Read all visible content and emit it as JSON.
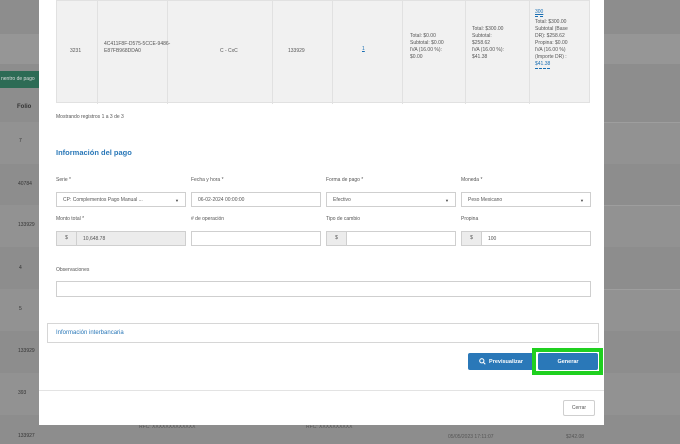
{
  "background": {
    "tab_label": "nentro de pago",
    "folio_header": "Folio",
    "folio_rows": [
      "7",
      "40784",
      "133929",
      "4",
      "5",
      "133929",
      "393",
      "133927"
    ],
    "bottom_texts": [
      "RFC: XXXXXXXXXXXXX",
      "RFC: XXXXXXXXXX",
      "05/05/2023 17:11:07",
      "$242.08"
    ]
  },
  "table": {
    "row": {
      "num": "3231",
      "uuid": "4C411F8F-D575-5CCE-9486-E87FB968DDA0",
      "type": "C - CxC",
      "folio": "133929",
      "link": "1",
      "col1": [
        "Total: $0.00",
        "Subtotal: $0.00",
        "IVA (16.00 %):",
        "$0.00"
      ],
      "col2": [
        "Total: $300.00",
        "Subtotal:",
        "$258.62",
        "IVA (16.00 %):",
        "$41.38"
      ],
      "col3_link": "300",
      "col3": [
        "Total: $300.00",
        "Subtotal (Base",
        "DR): $258.62",
        "Propina: $0.00",
        "IVA (16.00 %)",
        "(Importe DR) :",
        "$41.38"
      ]
    }
  },
  "showing_text": "Mostrando registros 1 a 3 de 3",
  "section_title": "Información del pago",
  "form": {
    "serie": {
      "label": "Serie *",
      "value": "CP: Complementos Pago Manual ..."
    },
    "fecha": {
      "label": "Fecha y hora *",
      "value": "06-02-2024 00:00:00"
    },
    "forma_pago": {
      "label": "Forma de pago *",
      "value": "Efectivo"
    },
    "moneda": {
      "label": "Moneda *",
      "value": "Peso Mexicano"
    },
    "monto": {
      "label": "Monto total *",
      "prefix": "$",
      "value": "10,648.78"
    },
    "operacion": {
      "label": "# de operación",
      "value": ""
    },
    "tipo_cambio": {
      "label": "Tipo de cambio",
      "prefix": "$",
      "value": ""
    },
    "propina": {
      "label": "Propina",
      "prefix": "$",
      "value": "100"
    },
    "observaciones": {
      "label": "Observaciones",
      "value": ""
    }
  },
  "interbank_label": "Información interbancaria",
  "buttons": {
    "preview": "Previsualizar",
    "generate": "Generar",
    "cancel": "Cerrar"
  },
  "colors": {
    "accent": "#2a78b8",
    "highlight": "#1fd01f"
  }
}
